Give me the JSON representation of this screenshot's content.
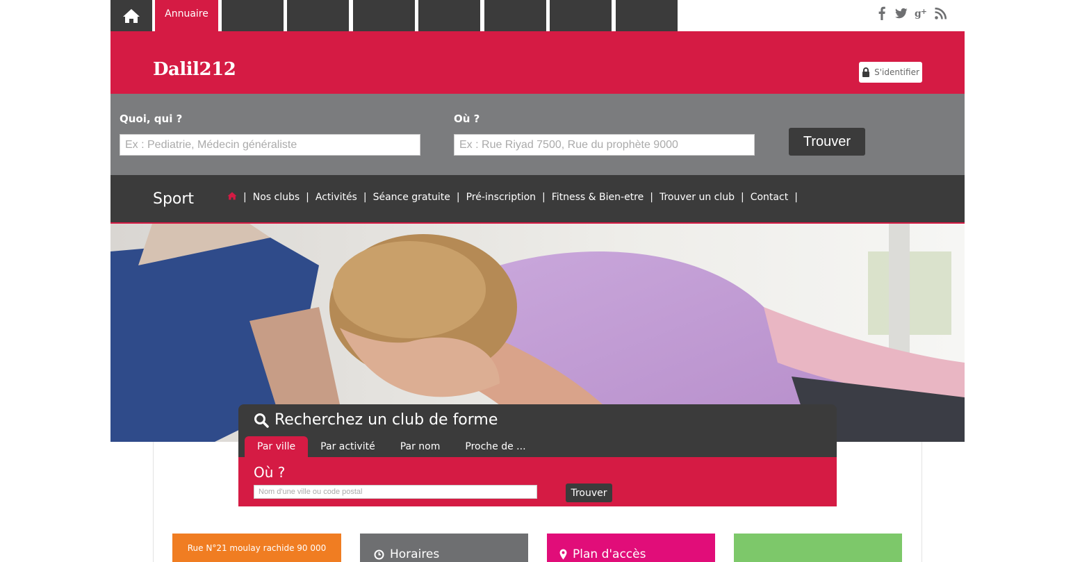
{
  "topnav": {
    "active_tab": "Annuaire",
    "empty_tab_count": 7
  },
  "colors": {
    "brand_red": "#d51b44",
    "dark": "#3b3b3b",
    "grey": "#7b7c7e",
    "orange": "#f07d22",
    "magenta": "#e10d79",
    "green": "#7dc86a"
  },
  "social": [
    "facebook-icon",
    "twitter-icon",
    "google-plus-icon",
    "rss-icon"
  ],
  "header": {
    "logo": "Dalil212",
    "login_label": "S'identifier"
  },
  "search": {
    "what_label": "Quoi, qui ?",
    "what_placeholder": "Ex : Pediatrie, Médecin généraliste",
    "where_label": "Où ?",
    "where_placeholder": "Ex : Rue Riyad 7500, Rue du prophète 9000",
    "button": "Trouver"
  },
  "sport": {
    "title": "Sport",
    "menu": [
      "Nos clubs",
      "Activités",
      "Séance gratuite",
      "Pré-inscription",
      "Fitness & Bien-etre",
      "Trouver un club",
      "Contact"
    ]
  },
  "panel": {
    "title": "Recherchez un club de forme",
    "tabs": [
      "Par ville",
      "Par activité",
      "Par nom",
      "Proche de ..."
    ],
    "where_label": "Où ?",
    "input_placeholder": "Nom d'une ville ou code postal",
    "button": "Trouver"
  },
  "tiles": {
    "address": "Rue N°21 moulay rachide 90 000",
    "hours": "Horaires",
    "map": "Plan d'accès"
  }
}
